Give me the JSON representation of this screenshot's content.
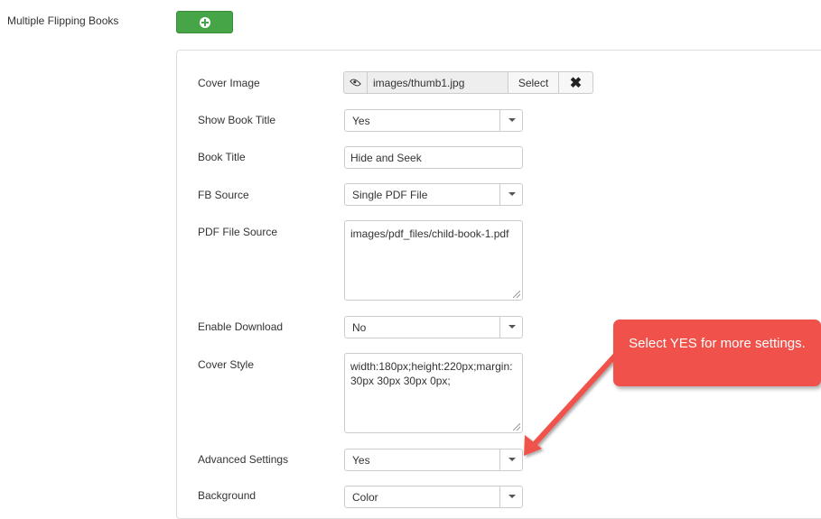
{
  "header": {
    "section_label": "Multiple Flipping Books",
    "add_icon": "plus-circle-icon",
    "add_color": "#46a546"
  },
  "form": {
    "cover_image": {
      "label": "Cover Image",
      "path": "images/thumb1.jpg",
      "select_label": "Select",
      "clear_icon": "close-icon",
      "preview_icon": "eye-icon"
    },
    "show_book_title": {
      "label": "Show Book Title",
      "value": "Yes"
    },
    "book_title": {
      "label": "Book Title",
      "value": "Hide and Seek"
    },
    "fb_source": {
      "label": "FB Source",
      "value": "Single PDF File"
    },
    "pdf_file_source": {
      "label": "PDF File Source",
      "value": "images/pdf_files/child-book-1.pdf"
    },
    "enable_download": {
      "label": "Enable Download",
      "value": "No"
    },
    "cover_style": {
      "label": "Cover Style",
      "value": "width:180px;height:220px;margin:\n30px 30px 30px 0px;"
    },
    "advanced_settings": {
      "label": "Advanced Settings",
      "value": "Yes"
    },
    "background": {
      "label": "Background",
      "value": "Color"
    }
  },
  "callout": {
    "text": "Select YES for more settings.",
    "color": "#f0524b"
  }
}
